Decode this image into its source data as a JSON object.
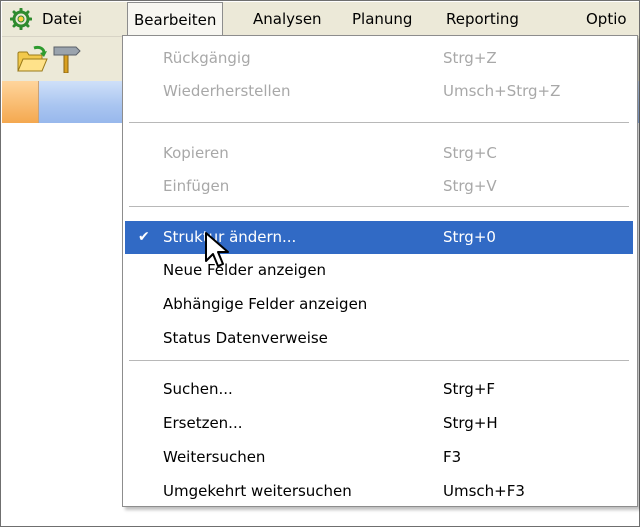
{
  "menubar": {
    "items": [
      {
        "label": "Datei"
      },
      {
        "label": "Bearbeiten",
        "active": true
      },
      {
        "label": "Analysen"
      },
      {
        "label": "Planung"
      },
      {
        "label": "Reporting"
      },
      {
        "label": "Optio"
      }
    ]
  },
  "toolbar": {
    "icons": [
      "open-folder-icon",
      "signpost-icon"
    ]
  },
  "menu": {
    "groups": [
      [
        {
          "label": "Rückgängig",
          "shortcut": "Strg+Z",
          "enabled": false
        },
        {
          "label": "Wiederherstellen",
          "shortcut": "Umsch+Strg+Z",
          "enabled": false
        }
      ],
      [
        {
          "label": "Kopieren",
          "shortcut": "Strg+C",
          "enabled": false
        },
        {
          "label": "Einfügen",
          "shortcut": "Strg+V",
          "enabled": false
        }
      ],
      [
        {
          "label": "Struktur ändern...",
          "shortcut": "Strg+0",
          "enabled": true,
          "checked": true,
          "highlighted": true
        },
        {
          "label": "Neue Felder anzeigen",
          "shortcut": "",
          "enabled": true
        },
        {
          "label": "Abhängige Felder anzeigen",
          "shortcut": "",
          "enabled": true
        },
        {
          "label": "Status Datenverweise",
          "shortcut": "",
          "enabled": true
        }
      ],
      [
        {
          "label": "Suchen...",
          "shortcut": "Strg+F",
          "enabled": true
        },
        {
          "label": "Ersetzen...",
          "shortcut": "Strg+H",
          "enabled": true
        },
        {
          "label": "Weitersuchen",
          "shortcut": "F3",
          "enabled": true
        },
        {
          "label": "Umgekehrt weitersuchen",
          "shortcut": "Umsch+F3",
          "enabled": true
        }
      ]
    ]
  },
  "colors": {
    "highlight": "#316ac5",
    "disabled_text": "#a8a8a8",
    "menubar_bg": "#ece9d8"
  }
}
